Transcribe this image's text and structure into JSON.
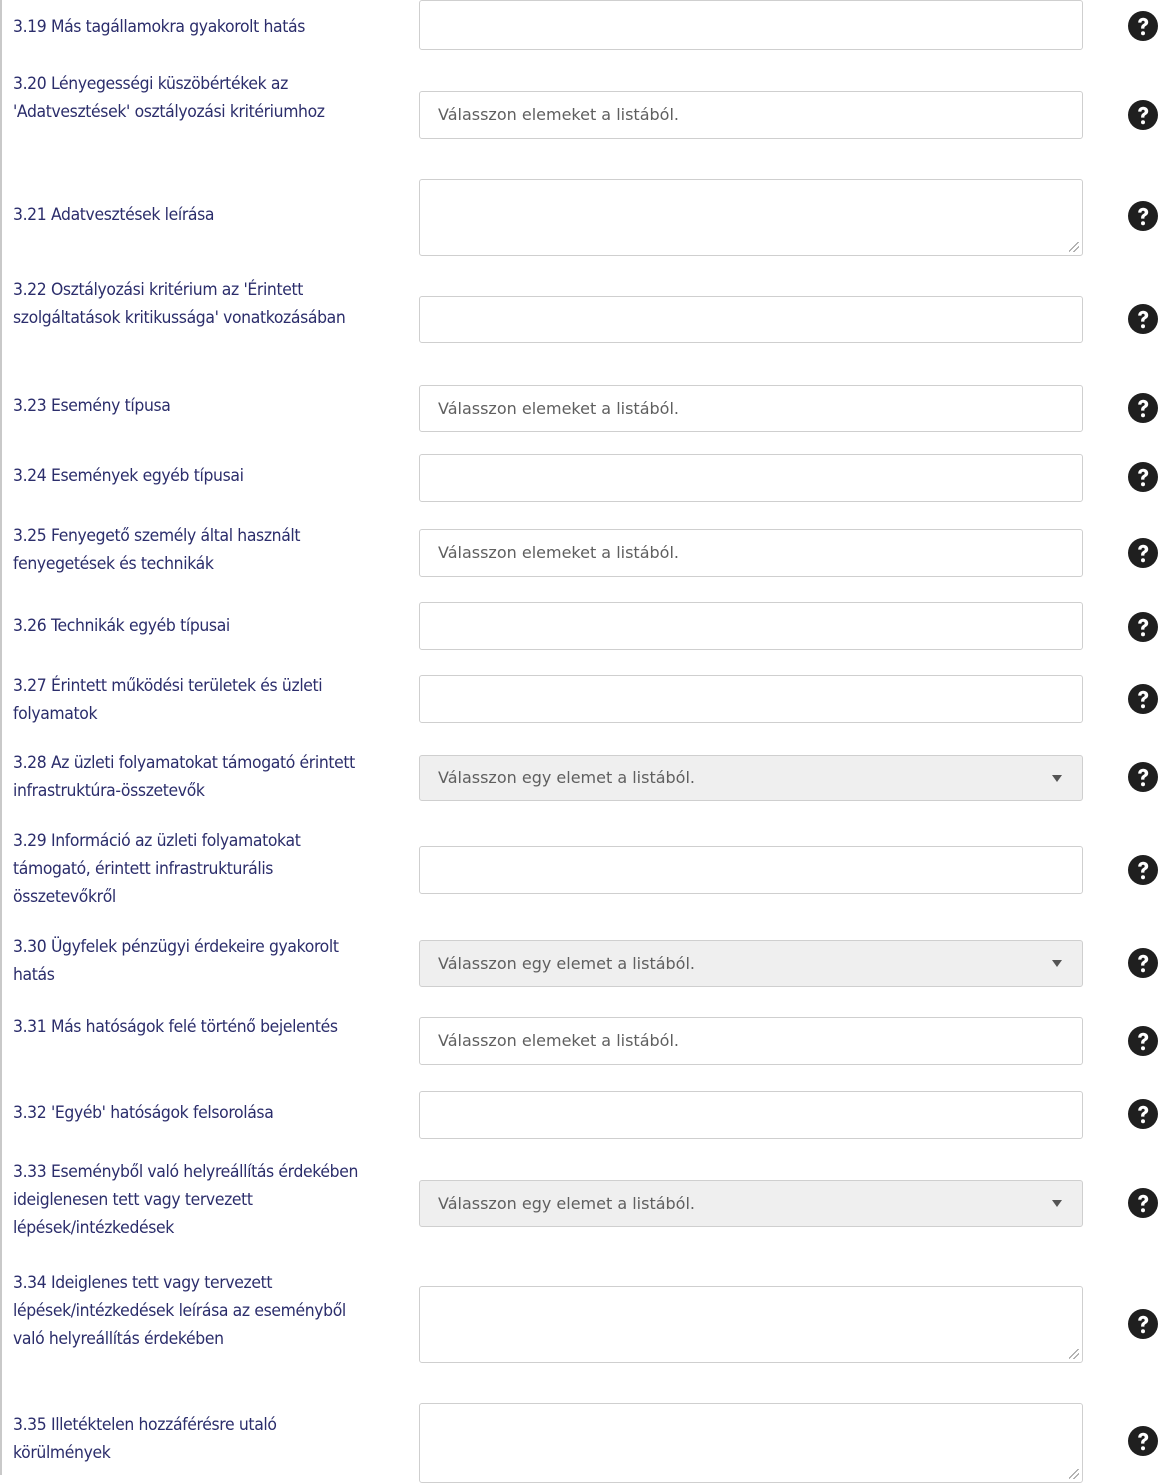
{
  "colors": {
    "label": "#2b2d6b",
    "help_icon": "#1f1f1f",
    "select_bg": "#efefef",
    "border": "#cfcfcf"
  },
  "rows": [
    {
      "label": "3.19 Más tagállamokra gyakorolt hatás",
      "control": "text",
      "value": "",
      "help_icon": "question-circle-icon"
    },
    {
      "label": "3.20 Lényegességi küszöbértékek az 'Adatvesztések' osztályozási kritériumhoz",
      "control": "multiselect",
      "placeholder": "Válasszon elemeket a listából.",
      "help_icon": "question-circle-icon"
    },
    {
      "label": "3.21 Adatvesztések leírása",
      "control": "textarea",
      "value": "",
      "help_icon": "question-circle-icon"
    },
    {
      "label": "3.22 Osztályozási kritérium az 'Érintett szolgáltatások kritikussága' vonatkozásában",
      "control": "text",
      "value": "",
      "help_icon": "question-circle-icon"
    },
    {
      "label": "3.23 Esemény típusa",
      "control": "multiselect",
      "placeholder": "Válasszon elemeket a listából.",
      "help_icon": "question-circle-icon"
    },
    {
      "label": "3.24 Események egyéb típusai",
      "control": "text",
      "value": "",
      "help_icon": "question-circle-icon"
    },
    {
      "label": "3.25 Fenyegető személy által használt fenyegetések és technikák",
      "control": "multiselect",
      "placeholder": "Válasszon elemeket a listából.",
      "help_icon": "question-circle-icon"
    },
    {
      "label": "3.26 Technikák egyéb típusai",
      "control": "text",
      "value": "",
      "help_icon": "question-circle-icon"
    },
    {
      "label": "3.27 Érintett működési területek és üzleti folyamatok",
      "control": "text",
      "value": "",
      "help_icon": "question-circle-icon"
    },
    {
      "label": "3.28 Az üzleti folyamatokat támogató érintett infrastruktúra-összetevők",
      "control": "select",
      "placeholder": "Válasszon egy elemet a listából.",
      "help_icon": "question-circle-icon"
    },
    {
      "label": "3.29 Információ az üzleti folyamatokat támogató, érintett infrastrukturális összetevőkről",
      "control": "text",
      "value": "",
      "help_icon": "question-circle-icon"
    },
    {
      "label": "3.30 Ügyfelek pénzügyi érdekeire gyakorolt hatás",
      "control": "select",
      "placeholder": "Válasszon egy elemet a listából.",
      "help_icon": "question-circle-icon"
    },
    {
      "label": "3.31 Más hatóságok felé történő bejelentés",
      "control": "multiselect",
      "placeholder": "Válasszon elemeket a listából.",
      "help_icon": "question-circle-icon"
    },
    {
      "label": "3.32 'Egyéb' hatóságok felsorolása",
      "control": "text",
      "value": "",
      "help_icon": "question-circle-icon"
    },
    {
      "label": "3.33 Eseményből való helyreállítás érdekében ideiglenesen tett vagy tervezett lépések/intézkedések",
      "control": "select",
      "placeholder": "Válasszon egy elemet a listából.",
      "help_icon": "question-circle-icon"
    },
    {
      "label": "3.34 Ideiglenes tett vagy tervezett lépések/intézkedések leírása az eseményből való helyreállítás érdekében",
      "control": "textarea",
      "value": "",
      "help_icon": "question-circle-icon"
    },
    {
      "label": "3.35 Illetéktelen hozzáférésre utaló körülmények",
      "control": "textarea",
      "value": "",
      "help_icon": "question-circle-icon"
    }
  ]
}
